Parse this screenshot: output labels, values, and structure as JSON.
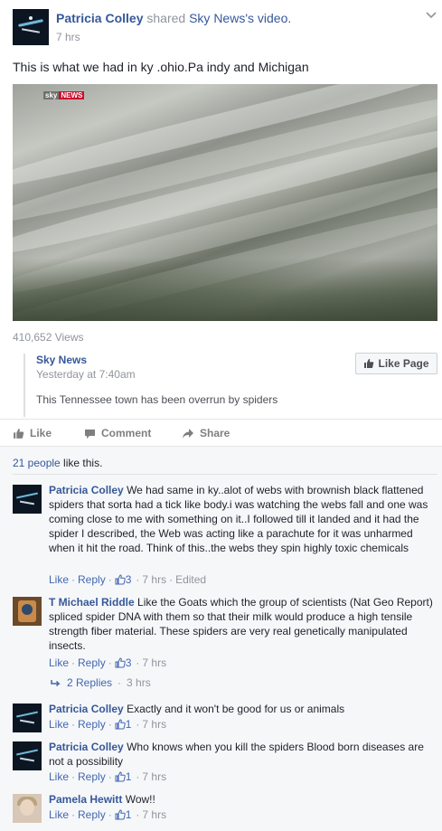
{
  "post": {
    "author": "Patricia Colley",
    "shared_text": "shared",
    "shared_page": "Sky News",
    "shared_suffix": "'s video.",
    "time": "7 hrs",
    "message": "This is what we had in ky .ohio.Pa indy and Michigan",
    "video_logo_sky": "sky",
    "video_logo_news": "NEWS",
    "views": "410,652 Views"
  },
  "shared_page": {
    "name": "Sky News",
    "time": "Yesterday at 7:40am",
    "description": "This Tennessee town has been overrun by spiders",
    "like_page_label": "Like Page"
  },
  "actions": {
    "like": "Like",
    "comment": "Comment",
    "share": "Share"
  },
  "likes_summary": {
    "count": "21 people",
    "suffix": " like this."
  },
  "comments": [
    {
      "author": "Patricia Colley",
      "text": "We had same in ky..alot of webs with brownish black flattened spiders that sorta had a tick like body.i was watching the webs fall and one was coming close to me with something on it..I followed till it landed and it had the spider I described, the Web was acting like a parachute for it was unharmed when it hit the road. Think of this..the webs they spin highly toxic chemicals",
      "like": "Like",
      "reply": "Reply",
      "reactions": "3",
      "time": "7 hrs",
      "edited": "Edited"
    },
    {
      "author": "T Michael Riddle",
      "text": "Like the Goats which the group of scientists (Nat Geo Report) spliced spider DNA with them so that their milk would produce a high tensile strength fiber material. These spiders are very real genetically manipulated insects.",
      "like": "Like",
      "reply": "Reply",
      "reactions": "3",
      "time": "7 hrs",
      "replies_label": "2 Replies",
      "replies_time": "3 hrs"
    },
    {
      "author": "Patricia Colley",
      "text": "Exactly and it won't be good for us or animals",
      "like": "Like",
      "reply": "Reply",
      "reactions": "1",
      "time": "7 hrs"
    },
    {
      "author": "Patricia Colley",
      "text": "Who knows when you kill the spiders Blood born diseases are not a possibility",
      "like": "Like",
      "reply": "Reply",
      "reactions": "1",
      "time": "7 hrs"
    },
    {
      "author": "Pamela Hewitt",
      "text": "Wow!!",
      "like": "Like",
      "reply": "Reply",
      "reactions": "1",
      "time": "7 hrs"
    }
  ],
  "colors": {
    "link": "#365899",
    "meta": "#90949c",
    "sky_red": "#c8102e",
    "comments_bg": "#f6f7f9"
  },
  "icons": [
    "chevron-down-icon",
    "thumb-up-icon",
    "comment-icon",
    "share-arrow-icon",
    "reply-arrow-icon"
  ]
}
